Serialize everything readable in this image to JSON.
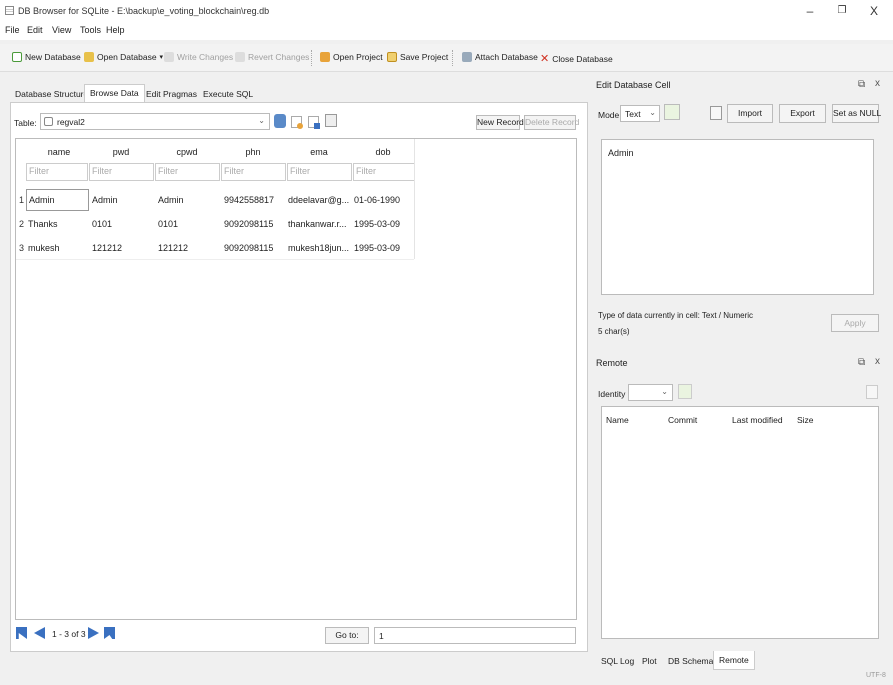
{
  "window": {
    "title": "DB Browser for SQLite - E:\\backup\\e_voting_blockchain\\reg.db",
    "minimize": "–",
    "maximize": "❐",
    "close": "X"
  },
  "menu": [
    "File",
    "Edit",
    "View",
    "Tools",
    "Help"
  ],
  "toolbar": {
    "new_database": "New Database",
    "open_database": "Open Database",
    "write_changes": "Write Changes",
    "revert_changes": "Revert Changes",
    "open_project": "Open Project",
    "save_project": "Save Project",
    "attach_database": "Attach Database",
    "close_database": "Close Database"
  },
  "tabs": [
    "Database Structure",
    "Browse Data",
    "Edit Pragmas",
    "Execute SQL"
  ],
  "browse": {
    "table_label": "Table:",
    "table_value": "regval2",
    "new_record": "New Record",
    "delete_record": "Delete Record",
    "columns": [
      "name",
      "pwd",
      "cpwd",
      "phn",
      "ema",
      "dob"
    ],
    "filter_placeholder": "Filter",
    "row_numbers": [
      "1",
      "2",
      "3"
    ],
    "rows": [
      [
        "Admin",
        "Admin",
        "Admin",
        "9942558817",
        "ddeelavar@g...",
        "01-06-1990"
      ],
      [
        "Thanks",
        "0101",
        "0101",
        "9092098115",
        "thankanwar.r...",
        "1995-03-09"
      ],
      [
        "mukesh",
        "121212",
        "121212",
        "9092098115",
        "mukesh18jun...",
        "1995-03-09"
      ]
    ],
    "page_info": "1 - 3 of 3",
    "goto_label": "Go to:",
    "goto_value": "1"
  },
  "edit_cell": {
    "title": "Edit Database Cell",
    "mode_label": "Mode:",
    "mode_value": "Text",
    "import": "Import",
    "export": "Export",
    "set_null": "Set as NULL",
    "content": "Admin",
    "type_info": "Type of data currently in cell: Text / Numeric",
    "size_info": "5 char(s)",
    "apply": "Apply"
  },
  "remote": {
    "title": "Remote",
    "identity_label": "Identity",
    "columns": [
      "Name",
      "Commit",
      "Last modified",
      "Size"
    ]
  },
  "bottom_tabs": [
    "SQL Log",
    "Plot",
    "DB Schema",
    "Remote"
  ],
  "status": "UTF-8",
  "colors": {
    "green": "#4a9a3a",
    "orange": "#e8a33a",
    "red": "#d03020",
    "blue": "#3a70c0"
  }
}
